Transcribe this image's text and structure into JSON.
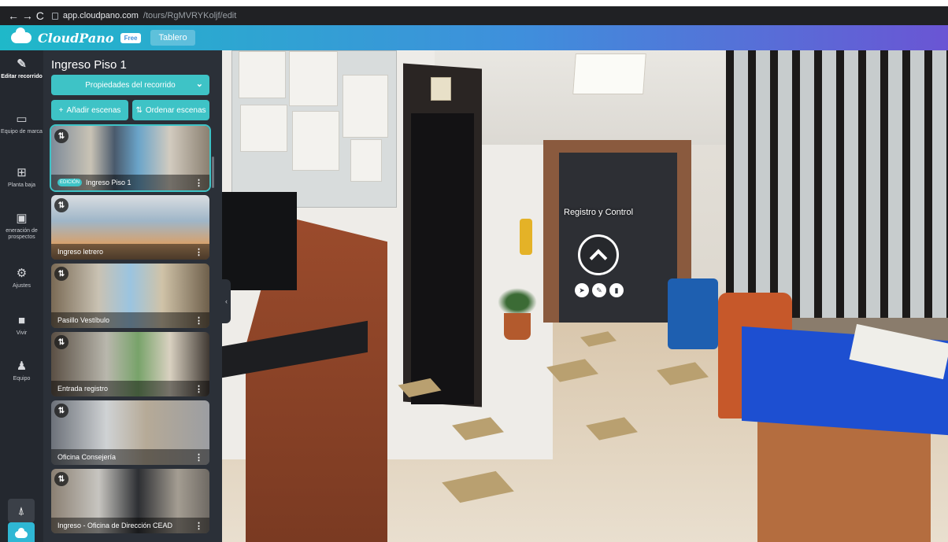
{
  "browser": {
    "nav": "← → C",
    "url_host": "app.cloudpano.com",
    "url_path": "/tours/RgMVRYKoljf/edit"
  },
  "header": {
    "brand": "CloudPano",
    "plan_badge": "Free",
    "dashboard_button": "Tablero"
  },
  "rail": {
    "items": [
      {
        "label": "Editar recorrido",
        "icon": "edit-icon"
      },
      {
        "label": "Equipo de marca",
        "icon": "briefcase-icon"
      },
      {
        "label": "Planta baja",
        "icon": "floorplan-icon"
      },
      {
        "label": "eneración de prospectos",
        "icon": "leads-icon"
      },
      {
        "label": "Ajustes",
        "icon": "gear-icon"
      },
      {
        "label": "Vivir",
        "icon": "video-icon"
      },
      {
        "label": "Equipo",
        "icon": "team-icon"
      }
    ]
  },
  "panel": {
    "title": "Ingreso Piso 1",
    "tour_properties": "Propiedades del recorrido",
    "add_scenes": "Añadir escenas",
    "sort_scenes": "Ordenar escenas",
    "edit_tag": "EDICIÓN",
    "scenes": [
      {
        "name": "Ingreso Piso 1"
      },
      {
        "name": "Ingreso letrero"
      },
      {
        "name": "Pasillo Vestíbulo"
      },
      {
        "name": "Entrada registro"
      },
      {
        "name": "Oficina Consejería"
      },
      {
        "name": "Ingreso - Oficina de Dirección CEAD"
      }
    ]
  },
  "viewer": {
    "hotspot_label": "Registro y Control"
  },
  "colors": {
    "accent": "#3ec3c6",
    "rail_bg": "#24282f",
    "panel_bg": "#2b3038"
  }
}
